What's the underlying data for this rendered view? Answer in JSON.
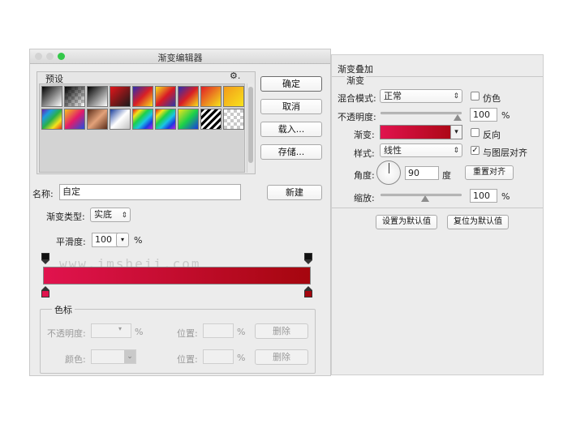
{
  "editor": {
    "title": "渐变编辑器",
    "presets_label": "预设",
    "gear_glyph": "⚙.",
    "buttons": {
      "ok": "确定",
      "cancel": "取消",
      "load": "载入...",
      "save": "存储...",
      "new": "新建"
    },
    "name_label": "名称:",
    "name_value": "自定",
    "gradient_type_label": "渐变类型:",
    "gradient_type_value": "实底",
    "smoothness_label": "平滑度:",
    "smoothness_value": "100",
    "smoothness_unit": "%",
    "gradient_colors": [
      "#e1134e",
      "#a5060e"
    ],
    "color_stops_group": {
      "title": "色标",
      "opacity_label": "不透明度:",
      "opacity_unit": "%",
      "location_label": "位置:",
      "location_unit": "%",
      "delete_label": "删除",
      "color_label": "颜色:",
      "location_label_2": "位置:",
      "location_unit_2": "%",
      "delete_label_2": "删除"
    }
  },
  "watermark": "www.jmsheji.com",
  "layer_style": {
    "title": "渐变叠加",
    "section": "渐变",
    "blend_mode_label": "混合模式:",
    "blend_mode_value": "正常",
    "dither_label": "仿色",
    "opacity_label": "不透明度:",
    "opacity_value": "100",
    "opacity_unit": "%",
    "gradient_label": "渐变:",
    "reverse_label": "反向",
    "style_label": "样式:",
    "style_value": "线性",
    "align_label": "与图层对齐",
    "align_checked": true,
    "angle_label": "角度:",
    "angle_value": "90",
    "angle_unit": "度",
    "reset_align_label": "重置对齐",
    "scale_label": "缩放:",
    "scale_value": "100",
    "scale_unit": "%",
    "set_default_label": "设置为默认值",
    "reset_default_label": "复位为默认值"
  }
}
